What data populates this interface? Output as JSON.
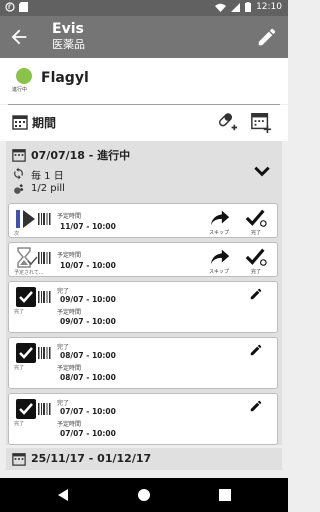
{
  "status_bar": {
    "time": "12:10"
  },
  "app_bar": {
    "title": "Evis",
    "subtitle": "医薬品"
  },
  "drug": {
    "name": "Flagyl",
    "status_label": "進行中",
    "status_color": "#8bc34a"
  },
  "period_section": {
    "label": "期間"
  },
  "current_period": {
    "dates": "07/07/18 - 進行中",
    "frequency": "毎 1 日",
    "dose": "1/2 pill"
  },
  "doses": [
    {
      "state": "次",
      "scheduled_label": "予定時間",
      "scheduled_time": "11/07 - 10:00",
      "skip_label": "スキップ",
      "done_label": "完了"
    },
    {
      "state": "予定されて...",
      "scheduled_label": "予定時間",
      "scheduled_time": "10/07 - 10:00",
      "skip_label": "スキップ",
      "done_label": "完了"
    },
    {
      "state": "完了",
      "done_label": "完了",
      "done_time": "09/07 - 10:00",
      "scheduled_label": "予定時間",
      "scheduled_time": "09/07 - 10:00"
    },
    {
      "state": "完了",
      "done_label": "完了",
      "done_time": "08/07 - 10:00",
      "scheduled_label": "予定時間",
      "scheduled_time": "08/07 - 10:00"
    },
    {
      "state": "完了",
      "done_label": "完了",
      "done_time": "07/07 - 10:00",
      "scheduled_label": "予定時間",
      "scheduled_time": "07/07 - 10:00"
    }
  ],
  "previous_period": {
    "dates": "25/11/17 - 01/12/17"
  },
  "colors": {
    "app_bar": "#757575",
    "status_bar": "#616161",
    "card_bg": "#e0e0e0",
    "active": "#8bc34a"
  }
}
